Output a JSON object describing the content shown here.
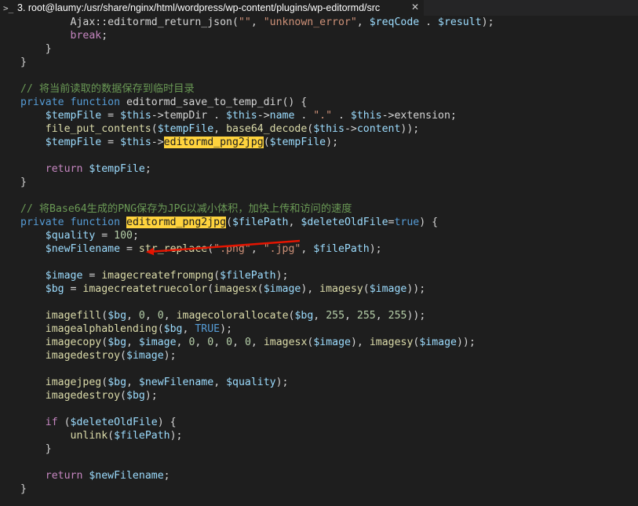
{
  "window": {
    "tab_icon": ">_",
    "tab_title": "3. root@laumy:/usr/share/nginx/html/wordpress/wp-content/plugins/wp-editormd/src",
    "close_glyph": "✕"
  },
  "editor": {
    "lines": [
      [
        [
          "        Ajax",
          ""
        ],
        [
          "::",
          ""
        ],
        [
          "editormd_return_json",
          ""
        ],
        [
          "(",
          ""
        ],
        [
          "\"\"",
          "st"
        ],
        [
          ", ",
          ""
        ],
        [
          "\"unknown_error\"",
          "st"
        ],
        [
          ", ",
          ""
        ],
        [
          "$reqCode",
          "vr"
        ],
        [
          " . ",
          ""
        ],
        [
          "$result",
          "vr"
        ],
        [
          ");",
          ""
        ]
      ],
      [
        [
          "        ",
          ""
        ],
        [
          "break",
          "ctl"
        ],
        [
          ";",
          ""
        ]
      ],
      [
        [
          "    }",
          ""
        ]
      ],
      [
        [
          "}",
          ""
        ]
      ],
      [],
      [
        [
          "// 将当前读取的数据保存到临时目录",
          "cm"
        ]
      ],
      [
        [
          "private",
          "kw"
        ],
        [
          " ",
          ""
        ],
        [
          "function",
          "kw"
        ],
        [
          " editormd_save_to_temp_dir() {",
          ""
        ]
      ],
      [
        [
          "    ",
          ""
        ],
        [
          "$tempFile",
          "vr"
        ],
        [
          " = ",
          ""
        ],
        [
          "$this",
          "vr"
        ],
        [
          "->tempDir . ",
          ""
        ],
        [
          "$this",
          "vr"
        ],
        [
          "->",
          ""
        ],
        [
          "name",
          "vr"
        ],
        [
          " . ",
          ""
        ],
        [
          "\".\"",
          "st"
        ],
        [
          " . ",
          ""
        ],
        [
          "$this",
          "vr"
        ],
        [
          "->extension;",
          ""
        ]
      ],
      [
        [
          "    ",
          ""
        ],
        [
          "file_put_contents",
          "fn"
        ],
        [
          "(",
          ""
        ],
        [
          "$tempFile",
          "vr"
        ],
        [
          ", ",
          ""
        ],
        [
          "base64_decode",
          "fn"
        ],
        [
          "(",
          ""
        ],
        [
          "$this",
          "vr"
        ],
        [
          "->",
          ""
        ],
        [
          "content",
          "vr"
        ],
        [
          "));",
          ""
        ]
      ],
      [
        [
          "    ",
          ""
        ],
        [
          "$tempFile",
          "vr"
        ],
        [
          " = ",
          ""
        ],
        [
          "$this",
          "vr"
        ],
        [
          "->",
          ""
        ],
        [
          "editormd_png2jpg",
          "hl"
        ],
        [
          "(",
          ""
        ],
        [
          "$tempFile",
          "vr"
        ],
        [
          ");",
          ""
        ]
      ],
      [],
      [
        [
          "    ",
          ""
        ],
        [
          "return",
          "ctl"
        ],
        [
          " ",
          ""
        ],
        [
          "$tempFile",
          "vr"
        ],
        [
          ";",
          ""
        ]
      ],
      [
        [
          "}",
          ""
        ]
      ],
      [],
      [
        [
          "// 将Base64生成的PNG保存为JPG以减小体积，加快上传和访问的速度",
          "cm"
        ]
      ],
      [
        [
          "private",
          "kw"
        ],
        [
          " ",
          ""
        ],
        [
          "function",
          "kw"
        ],
        [
          " ",
          ""
        ],
        [
          "editormd_png2jpg",
          "hl"
        ],
        [
          "(",
          ""
        ],
        [
          "$filePath",
          "vr"
        ],
        [
          ", ",
          ""
        ],
        [
          "$deleteOldFile",
          "vr"
        ],
        [
          "=",
          ""
        ],
        [
          "true",
          "kw"
        ],
        [
          ") {",
          ""
        ]
      ],
      [
        [
          "    ",
          ""
        ],
        [
          "$quality",
          "vr"
        ],
        [
          " = ",
          ""
        ],
        [
          "100",
          "nm"
        ],
        [
          ";",
          ""
        ]
      ],
      [
        [
          "    ",
          ""
        ],
        [
          "$newFilename",
          "vr"
        ],
        [
          " = ",
          ""
        ],
        [
          "str_replace",
          "fn"
        ],
        [
          "(",
          ""
        ],
        [
          "\".png\"",
          "st"
        ],
        [
          ", ",
          ""
        ],
        [
          "\".jpg\"",
          "st"
        ],
        [
          ", ",
          ""
        ],
        [
          "$filePath",
          "vr"
        ],
        [
          ");",
          ""
        ]
      ],
      [],
      [
        [
          "    ",
          ""
        ],
        [
          "$image",
          "vr"
        ],
        [
          " = ",
          ""
        ],
        [
          "imagecreatefrompng",
          "fn"
        ],
        [
          "(",
          ""
        ],
        [
          "$filePath",
          "vr"
        ],
        [
          ");",
          ""
        ]
      ],
      [
        [
          "    ",
          ""
        ],
        [
          "$bg",
          "vr"
        ],
        [
          " = ",
          ""
        ],
        [
          "imagecreatetruecolor",
          "fn"
        ],
        [
          "(",
          ""
        ],
        [
          "imagesx",
          "fn"
        ],
        [
          "(",
          ""
        ],
        [
          "$image",
          "vr"
        ],
        [
          "), ",
          ""
        ],
        [
          "imagesy",
          "fn"
        ],
        [
          "(",
          ""
        ],
        [
          "$image",
          "vr"
        ],
        [
          "));",
          ""
        ]
      ],
      [],
      [
        [
          "    ",
          ""
        ],
        [
          "imagefill",
          "fn"
        ],
        [
          "(",
          ""
        ],
        [
          "$bg",
          "vr"
        ],
        [
          ", ",
          ""
        ],
        [
          "0",
          "nm"
        ],
        [
          ", ",
          ""
        ],
        [
          "0",
          "nm"
        ],
        [
          ", ",
          ""
        ],
        [
          "imagecolorallocate",
          "fn"
        ],
        [
          "(",
          ""
        ],
        [
          "$bg",
          "vr"
        ],
        [
          ", ",
          ""
        ],
        [
          "255",
          "nm"
        ],
        [
          ", ",
          ""
        ],
        [
          "255",
          "nm"
        ],
        [
          ", ",
          ""
        ],
        [
          "255",
          "nm"
        ],
        [
          "));",
          ""
        ]
      ],
      [
        [
          "    ",
          ""
        ],
        [
          "imagealphablending",
          "fn"
        ],
        [
          "(",
          ""
        ],
        [
          "$bg",
          "vr"
        ],
        [
          ", ",
          ""
        ],
        [
          "TRUE",
          "kw"
        ],
        [
          ");",
          ""
        ]
      ],
      [
        [
          "    ",
          ""
        ],
        [
          "imagecopy",
          "fn"
        ],
        [
          "(",
          ""
        ],
        [
          "$bg",
          "vr"
        ],
        [
          ", ",
          ""
        ],
        [
          "$image",
          "vr"
        ],
        [
          ", ",
          ""
        ],
        [
          "0",
          "nm"
        ],
        [
          ", ",
          ""
        ],
        [
          "0",
          "nm"
        ],
        [
          ", ",
          ""
        ],
        [
          "0",
          "nm"
        ],
        [
          ", ",
          ""
        ],
        [
          "0",
          "nm"
        ],
        [
          ", ",
          ""
        ],
        [
          "imagesx",
          "fn"
        ],
        [
          "(",
          ""
        ],
        [
          "$image",
          "vr"
        ],
        [
          "), ",
          ""
        ],
        [
          "imagesy",
          "fn"
        ],
        [
          "(",
          ""
        ],
        [
          "$image",
          "vr"
        ],
        [
          "));",
          ""
        ]
      ],
      [
        [
          "    ",
          ""
        ],
        [
          "imagedestroy",
          "fn"
        ],
        [
          "(",
          ""
        ],
        [
          "$image",
          "vr"
        ],
        [
          ");",
          ""
        ]
      ],
      [],
      [
        [
          "    ",
          ""
        ],
        [
          "imagejpeg",
          "fn"
        ],
        [
          "(",
          ""
        ],
        [
          "$bg",
          "vr"
        ],
        [
          ", ",
          ""
        ],
        [
          "$newFilename",
          "vr"
        ],
        [
          ", ",
          ""
        ],
        [
          "$quality",
          "vr"
        ],
        [
          ");",
          ""
        ]
      ],
      [
        [
          "    ",
          ""
        ],
        [
          "imagedestroy",
          "fn"
        ],
        [
          "(",
          ""
        ],
        [
          "$bg",
          "vr"
        ],
        [
          ");",
          ""
        ]
      ],
      [],
      [
        [
          "    ",
          ""
        ],
        [
          "if",
          "ctl"
        ],
        [
          " (",
          ""
        ],
        [
          "$deleteOldFile",
          "vr"
        ],
        [
          ") {",
          ""
        ]
      ],
      [
        [
          "        ",
          ""
        ],
        [
          "unlink",
          "fn"
        ],
        [
          "(",
          ""
        ],
        [
          "$filePath",
          "vr"
        ],
        [
          ");",
          ""
        ]
      ],
      [
        [
          "    }",
          ""
        ]
      ],
      [],
      [
        [
          "    ",
          ""
        ],
        [
          "return",
          "ctl"
        ],
        [
          " ",
          ""
        ],
        [
          "$newFilename",
          "vr"
        ],
        [
          ";",
          ""
        ]
      ],
      [
        [
          "}",
          ""
        ]
      ]
    ]
  },
  "annotation": {
    "arrow_color": "#e51400"
  }
}
